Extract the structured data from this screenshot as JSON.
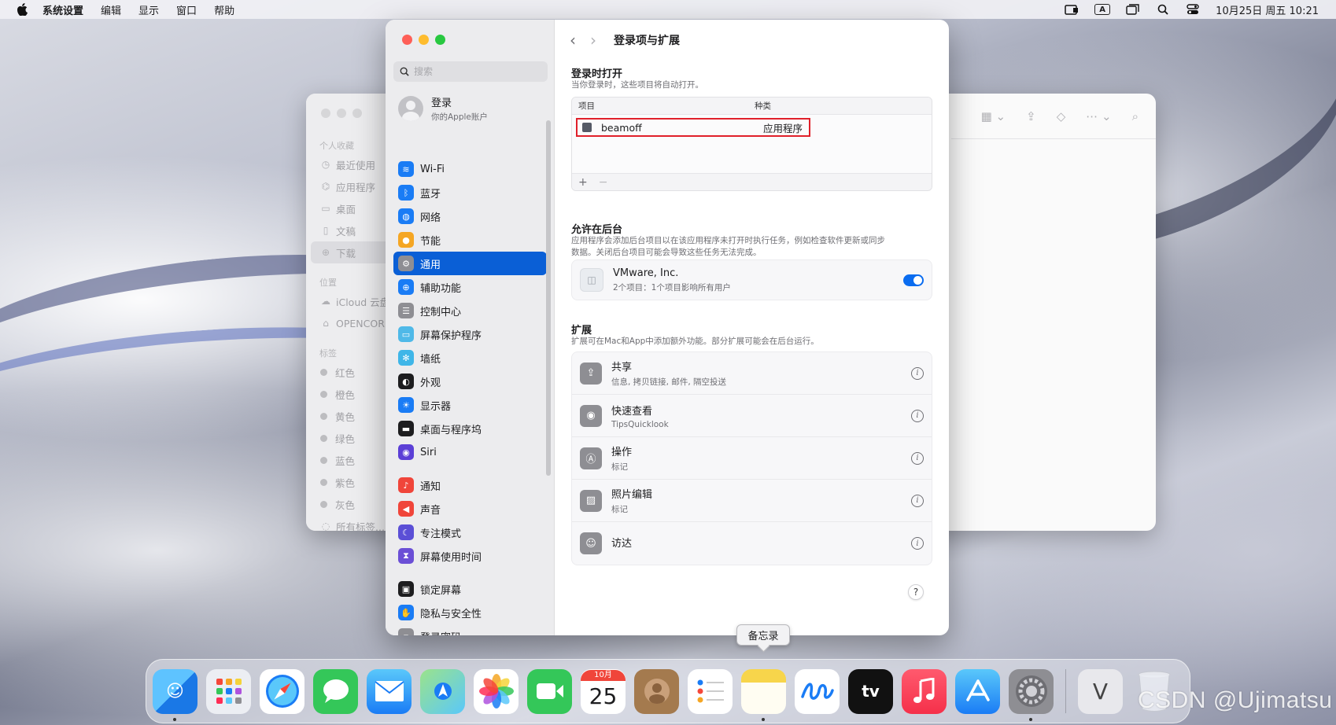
{
  "menubar": {
    "app_name": "系统设置",
    "items": [
      "编辑",
      "显示",
      "窗口",
      "帮助"
    ],
    "input_indicator": "A",
    "clock": "10月25日 周五  10:21"
  },
  "finder": {
    "sections": {
      "favorites": "个人收藏",
      "locations": "位置",
      "tags": "标签"
    },
    "favorites": [
      "最近使用",
      "应用程序",
      "桌面",
      "文稿",
      "下载"
    ],
    "locations": [
      "iCloud 云盘",
      "OPENCORE"
    ],
    "tags": [
      "红色",
      "橙色",
      "黄色",
      "绿色",
      "蓝色",
      "紫色",
      "灰色",
      "所有标签..."
    ]
  },
  "settings": {
    "search_placeholder": "搜索",
    "account": {
      "title": "登录",
      "subtitle": "你的Apple账户"
    },
    "sidebar": [
      {
        "label": "Wi-Fi",
        "icon": "wifi-icon",
        "color": "#1a7cf5",
        "glyph": "≋"
      },
      {
        "label": "蓝牙",
        "icon": "bluetooth-icon",
        "color": "#1a7cf5",
        "glyph": "ᛒ"
      },
      {
        "label": "网络",
        "icon": "globe-icon",
        "color": "#1a7cf5",
        "glyph": "◍"
      },
      {
        "label": "节能",
        "icon": "lightbulb-icon",
        "color": "#f5a623",
        "glyph": "●"
      },
      {
        "label": "通用",
        "icon": "gear-icon",
        "color": "#8e8e93",
        "glyph": "⚙",
        "selected": true
      },
      {
        "label": "辅助功能",
        "icon": "accessibility-icon",
        "color": "#1a7cf5",
        "glyph": "⊕"
      },
      {
        "label": "控制中心",
        "icon": "control-center-icon",
        "color": "#8e8e93",
        "glyph": "☰"
      },
      {
        "label": "屏幕保护程序",
        "icon": "screensaver-icon",
        "color": "#4fb9e8",
        "glyph": "▭"
      },
      {
        "label": "墙纸",
        "icon": "wallpaper-icon",
        "color": "#3fb6e8",
        "glyph": "✻"
      },
      {
        "label": "外观",
        "icon": "appearance-icon",
        "color": "#1d1d1f",
        "glyph": "◐"
      },
      {
        "label": "显示器",
        "icon": "display-icon",
        "color": "#1a7cf5",
        "glyph": "☀"
      },
      {
        "label": "桌面与程序坞",
        "icon": "dock-icon",
        "color": "#1d1d1f",
        "glyph": "▬"
      },
      {
        "label": "Siri",
        "icon": "siri-icon",
        "color": "#5b3fd6",
        "glyph": "◉"
      },
      {
        "label": "通知",
        "icon": "bell-icon",
        "color": "#f0453a",
        "glyph": "♪",
        "gap": true
      },
      {
        "label": "声音",
        "icon": "speaker-icon",
        "color": "#f0453a",
        "glyph": "◀"
      },
      {
        "label": "专注模式",
        "icon": "moon-icon",
        "color": "#5b4fd6",
        "glyph": "☾"
      },
      {
        "label": "屏幕使用时间",
        "icon": "hourglass-icon",
        "color": "#6b4fd6",
        "glyph": "⧗"
      },
      {
        "label": "锁定屏幕",
        "icon": "lock-icon",
        "color": "#1d1d1f",
        "glyph": "▣",
        "gap": true
      },
      {
        "label": "隐私与安全性",
        "icon": "hand-icon",
        "color": "#1a7cf5",
        "glyph": "✋"
      },
      {
        "label": "登录密码",
        "icon": "password-icon",
        "color": "#8e8e93",
        "glyph": "▪"
      }
    ],
    "main": {
      "title": "登录项与扩展",
      "login_open": {
        "title": "登录时打开",
        "desc": "当你登录时，这些项目将自动打开。",
        "col_item": "项目",
        "col_kind": "种类",
        "rows": [
          {
            "name": "beamoff",
            "kind": "应用程序"
          }
        ],
        "add": "+",
        "remove": "−"
      },
      "background": {
        "title": "允许在后台",
        "desc_line1": "应用程序会添加后台项目以在该应用程序未打开时执行任务，例如检查软件更新或同步",
        "desc_line2": "数据。关闭后台项目可能会导致这些任务无法完成。",
        "item_title": "VMware, Inc.",
        "item_sub": "2个项目：1个项目影响所有用户"
      },
      "extensions": {
        "title": "扩展",
        "desc": "扩展可在Mac和App中添加额外功能。部分扩展可能会在后台运行。",
        "rows": [
          {
            "title": "共享",
            "sub": "信息, 拷贝链接, 邮件, 隔空投送",
            "icon": "share-icon",
            "glyph": "⇪"
          },
          {
            "title": "快速查看",
            "sub": "TipsQuicklook",
            "icon": "eye-icon",
            "glyph": "◉"
          },
          {
            "title": "操作",
            "sub": "标记",
            "icon": "markup-icon",
            "glyph": "Ⓐ"
          },
          {
            "title": "照片编辑",
            "sub": "标记",
            "icon": "photo-edit-icon",
            "glyph": "▨"
          },
          {
            "title": "访达",
            "sub": "",
            "icon": "finder-icon",
            "glyph": "☺"
          }
        ]
      },
      "help": "?"
    }
  },
  "tooltip": "备忘录",
  "dock": {
    "calendar_month": "10月",
    "calendar_day": "25",
    "tv_label": "tv",
    "vm_label": "V"
  },
  "watermark": "CSDN @Ujimatsu"
}
